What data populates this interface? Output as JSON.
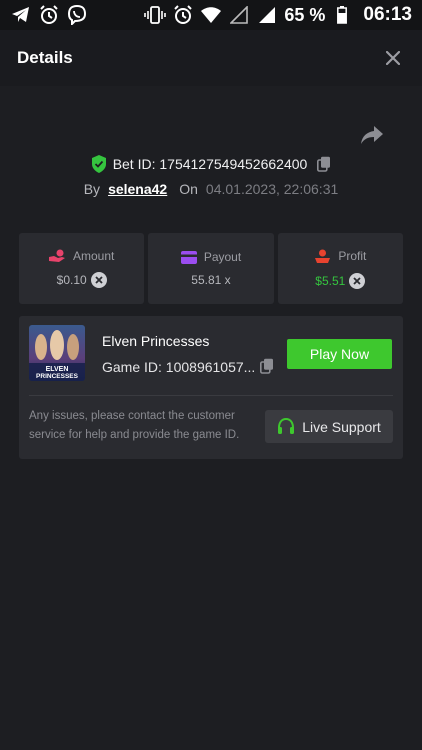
{
  "status_bar": {
    "left_icons": [
      "telegram-icon",
      "alarm-icon",
      "viber-icon"
    ],
    "right_icons": [
      "vibrate-icon",
      "alarm-icon",
      "wifi-icon",
      "signal-empty-icon",
      "signal-icon"
    ],
    "battery_text": "65 %",
    "time": "06:13"
  },
  "header": {
    "title": "Details",
    "close_icon": "close-icon"
  },
  "bet": {
    "share_icon": "share-icon",
    "bet_id_label": "Bet ID: 1754127549452662400",
    "by_label": "By",
    "username": "selena42",
    "on_label": "On",
    "date": "04.01.2023, 22:06:31"
  },
  "stats": [
    {
      "label": "Amount",
      "value": "$0.10",
      "icon": "hand-coin-icon",
      "color": "#e8436b"
    },
    {
      "label": "Payout",
      "value": "55.81 x",
      "icon": "card-icon",
      "color": "#9b4df0"
    },
    {
      "label": "Profit",
      "value": "$5.51",
      "icon": "profit-icon",
      "color": "#e8432f"
    }
  ],
  "game": {
    "thumbnail_text_1": "ELVEN",
    "thumbnail_text_2": "PRINCESSES",
    "title": "Elven Princesses",
    "game_id": "Game ID: 1008961057...",
    "play_label": "Play Now",
    "issues_text": "Any issues, please contact the customer service for help and provide the game ID.",
    "support_label": "Live Support"
  },
  "colors": {
    "accent_green": "#3ec82e",
    "profit_green": "#35c43f",
    "background": "#1d1e22",
    "card": "#2a2b30"
  }
}
